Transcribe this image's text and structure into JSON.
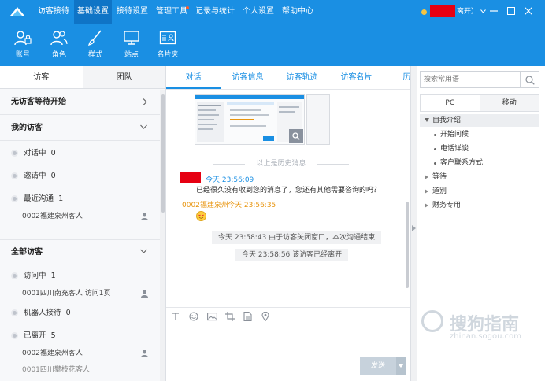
{
  "menu": {
    "items": [
      {
        "label": "访客接待",
        "active": false
      },
      {
        "label": "基础设置",
        "active": true
      },
      {
        "label": "接待设置",
        "active": false
      },
      {
        "label": "管理工具",
        "active": false,
        "badge": true
      },
      {
        "label": "记录与统计",
        "active": false
      },
      {
        "label": "个人设置",
        "active": false
      },
      {
        "label": "帮助中心",
        "active": false
      }
    ],
    "user_status": "离开）"
  },
  "toolbar": {
    "items": [
      {
        "label": "账号",
        "icon": "account-lock-icon"
      },
      {
        "label": "角色",
        "icon": "roles-icon"
      },
      {
        "label": "样式",
        "icon": "brush-icon"
      },
      {
        "label": "站点",
        "icon": "monitor-icon"
      },
      {
        "label": "名片夹",
        "icon": "card-holder-icon"
      }
    ]
  },
  "left": {
    "tabs": [
      {
        "label": "访客",
        "active": true
      },
      {
        "label": "团队",
        "active": false
      }
    ],
    "sections": {
      "waiting": "无访客等待开始",
      "mine": "我的访客",
      "all": "全部访客"
    },
    "my_groups": [
      {
        "label": "对话中",
        "count": "0"
      },
      {
        "label": "邀请中",
        "count": "0"
      },
      {
        "label": "最近沟通",
        "count": "1"
      }
    ],
    "my_recent_visitor": "0002福建泉州客人",
    "all_groups": [
      {
        "label": "访问中",
        "count": "1"
      },
      {
        "label": "机器人接待",
        "count": "0"
      },
      {
        "label": "已离开",
        "count": "5"
      }
    ],
    "visiting_visitor": "0001四川南充客人 访问1页",
    "left_visitors": [
      "0002福建泉州客人",
      "0001四川攀枝花客人"
    ]
  },
  "chat": {
    "tabs": [
      {
        "label": "对话",
        "active": true
      },
      {
        "label": "访客信息",
        "active": false
      },
      {
        "label": "访客轨迹",
        "active": false
      },
      {
        "label": "访客名片",
        "active": false
      },
      {
        "label": "历史",
        "active": false
      }
    ],
    "history_divider": "以上是历史消息",
    "agent_time": "今天 23:56:09",
    "agent_message": "已经很久没有收到您的消息了，您还有其他需要咨询的吗？",
    "visitor_name": "0002福建泉州",
    "visitor_time": "今天 23:56:35",
    "system_messages": [
      "今天 23:58:43 由于访客关闭窗口，本次沟通结束",
      "今天 23:58:56 该访客已经离开"
    ],
    "send_label": "发送"
  },
  "right": {
    "search_placeholder": "搜索常用语",
    "tabs": [
      {
        "label": "PC",
        "active": true
      },
      {
        "label": "移动",
        "active": false
      }
    ],
    "categories": [
      {
        "label": "自我介绍",
        "expanded": true,
        "items": [
          "开始问候",
          "电话详谈",
          "客户联系方式"
        ]
      },
      {
        "label": "等待",
        "expanded": false
      },
      {
        "label": "道别",
        "expanded": false
      },
      {
        "label": "财务专用",
        "expanded": false
      }
    ]
  },
  "watermark": {
    "text": "搜狗指南",
    "sub": "zhinan.sogou.com"
  },
  "colors": {
    "brand": "#1a8fe3",
    "menu_active": "#0f74c6",
    "link": "#1a8fe3",
    "visitor": "#e8950f",
    "redaction": "#e60012"
  }
}
